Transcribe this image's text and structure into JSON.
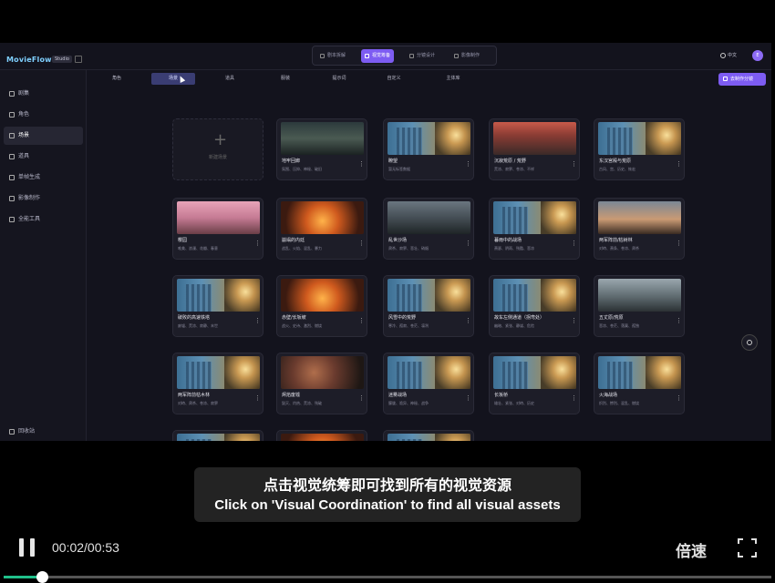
{
  "app": {
    "logo_name": "MovieFlow",
    "logo_badge": "Studio"
  },
  "top_tabs": [
    {
      "label": "剧本拆解"
    },
    {
      "label": "视觉筹备"
    },
    {
      "label": "分镜设计"
    },
    {
      "label": "影像制作"
    }
  ],
  "top_right": {
    "language": "中文",
    "avatar_initial": "E"
  },
  "sidebar": {
    "items": [
      {
        "label": "剧集",
        "icon": "film-icon"
      },
      {
        "label": "角色",
        "icon": "users-icon"
      },
      {
        "label": "场景",
        "icon": "scene-icon"
      },
      {
        "label": "道具",
        "icon": "box-icon"
      },
      {
        "label": "单帧生成",
        "icon": "frame-icon"
      },
      {
        "label": "影像制作",
        "icon": "video-icon"
      },
      {
        "label": "全能工具",
        "icon": "tools-icon"
      }
    ],
    "active_index": 2,
    "trash_label": "回收站"
  },
  "filters": {
    "tabs": [
      "角色",
      "场景",
      "道具",
      "服装",
      "提示词",
      "自定义",
      "主体库"
    ],
    "active_index": 1,
    "make_button": "去制作分镜"
  },
  "grid": {
    "add_label": "新建场景",
    "cards": [
      {
        "title": "地牢回廊",
        "tags": "氛围、压抑、神秘、破旧",
        "thumb": "dark"
      },
      {
        "title": "瞭望",
        "tags": "暂无标签数据",
        "thumb": "blue"
      },
      {
        "title": "沉寂荒原 / 荒野",
        "tags": "荒凉、寂寥、苍凉、不祥",
        "thumb": "red"
      },
      {
        "title": "东汉宫殿与荒原",
        "tags": "古风、宫、历史、恢宏",
        "thumb": "blue"
      },
      {
        "title": "樱园",
        "tags": "唯美、浪漫、花瓣、春意",
        "thumb": "pink"
      },
      {
        "title": "崩塌的内廷",
        "tags": "战乱、火焰、混乱、暴力",
        "thumb": "fire"
      },
      {
        "title": "乱世沙场",
        "tags": "肃杀、寂寥、悲壮、硝烟",
        "thumb": "grey"
      },
      {
        "title": "暮雨中的战场",
        "tags": "萧瑟、阴雨、残酷、悲凉",
        "thumb": "blue"
      },
      {
        "title": "两军阵前/枯树林",
        "tags": "对峙、萧条、苍凉、肃杀",
        "thumb": "dusk"
      },
      {
        "title": "破败的高速铁塔",
        "tags": "废墟、荒凉、寂静、末世",
        "thumb": "blue"
      },
      {
        "title": "赤壁/长坂坡",
        "tags": "战火、史诗、激烈、燃烧",
        "thumb": "fire"
      },
      {
        "title": "风雪中的荒野",
        "tags": "寒冷、孤寂、苍茫、凛冽",
        "thumb": "blue"
      },
      {
        "title": "故车左侧通道（拐弯处）",
        "tags": "幽暗、紧张、静谧、危险",
        "thumb": "blue"
      },
      {
        "title": "五丈原/荒原",
        "tags": "悲凉、苍茫、落寞、孤独",
        "thumb": "town"
      },
      {
        "title": "两军阵前枯木林",
        "tags": "对峙、肃杀、苍凉、寂寥",
        "thumb": "blue"
      },
      {
        "title": "烬焰废墟",
        "tags": "毁灭、灼热、荒凉、残破",
        "thumb": "ruin"
      },
      {
        "title": "迷雾战场",
        "tags": "朦胧、诡异、神秘、战争",
        "thumb": "blue"
      },
      {
        "title": "长坂桥",
        "tags": "雄壮、紧张、对峙、历史",
        "thumb": "blue"
      },
      {
        "title": "火海战场",
        "tags": "炽烈、惨烈、混乱、燃烧",
        "thumb": "blue"
      },
      {
        "title": "",
        "tags": "",
        "thumb": "blue"
      },
      {
        "title": "",
        "tags": "",
        "thumb": "fire"
      },
      {
        "title": "",
        "tags": "",
        "thumb": "blue"
      }
    ]
  },
  "subtitle": {
    "zh": "点击视觉统筹即可找到所有的视觉资源",
    "en": "Click on 'Visual Coordination' to find all visual assets"
  },
  "player": {
    "time": "00:02/00:53",
    "speed_label": "倍速",
    "progress": 0.04
  },
  "colors": {
    "accent": "#7d5cf2",
    "progress": "#20c08a",
    "app_bg": "#13131d"
  }
}
